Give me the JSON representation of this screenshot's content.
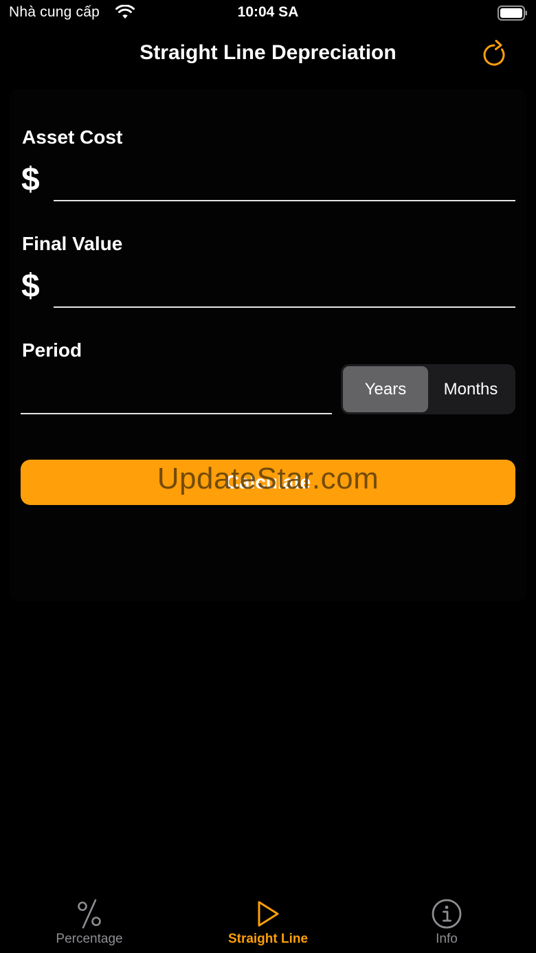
{
  "status_bar": {
    "carrier": "Nhà cung cấp",
    "time": "10:04 SA",
    "wifi_icon": "wifi-icon",
    "battery_icon": "battery-icon"
  },
  "nav": {
    "title": "Straight Line Depreciation",
    "refresh_icon": "refresh-icon"
  },
  "form": {
    "asset_cost": {
      "label": "Asset Cost",
      "currency": "$",
      "value": ""
    },
    "final_value": {
      "label": "Final Value",
      "currency": "$",
      "value": ""
    },
    "period": {
      "label": "Period",
      "value": "",
      "units": [
        "Years",
        "Months"
      ],
      "selected_unit": "Years"
    },
    "calculate_label": "Calculate"
  },
  "watermark": "UpdateStar.com",
  "tabs": [
    {
      "label": "Percentage",
      "icon": "percent-icon",
      "active": false
    },
    {
      "label": "Straight Line",
      "icon": "play-icon",
      "active": true
    },
    {
      "label": "Info",
      "icon": "info-icon",
      "active": false
    }
  ],
  "colors": {
    "accent": "#ff9f0a",
    "background": "#000000",
    "inactive_tab": "#8e8e93",
    "segment_selected": "#636366",
    "segment_track": "#1c1c1e"
  }
}
